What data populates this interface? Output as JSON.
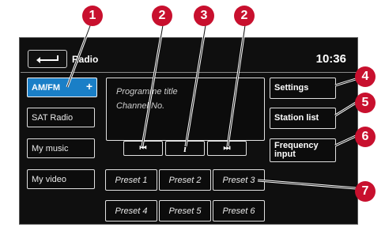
{
  "header": {
    "title": "Radio",
    "time": "10:36"
  },
  "sources": [
    {
      "label": "AM/FM",
      "active": true
    },
    {
      "label": "SAT Radio"
    },
    {
      "label": "My music"
    },
    {
      "label": "My video"
    }
  ],
  "source_plus": "+",
  "info": {
    "programme_title": "Programme title",
    "channel": "Channel No."
  },
  "transport": {
    "prev": "⏮",
    "info": "i",
    "next": "⏭"
  },
  "actions": {
    "settings": "Settings",
    "station_list": "Station list",
    "frequency_input": "Frequency input"
  },
  "presets": [
    "Preset 1",
    "Preset 2",
    "Preset 3",
    "Preset 4",
    "Preset 5",
    "Preset 6"
  ],
  "callouts": [
    "1",
    "2",
    "3",
    "2",
    "4",
    "5",
    "6",
    "7"
  ],
  "colors": {
    "accent": "#1a7fc7",
    "callout": "#c8102e",
    "screen_bg": "#0f0f0f"
  }
}
